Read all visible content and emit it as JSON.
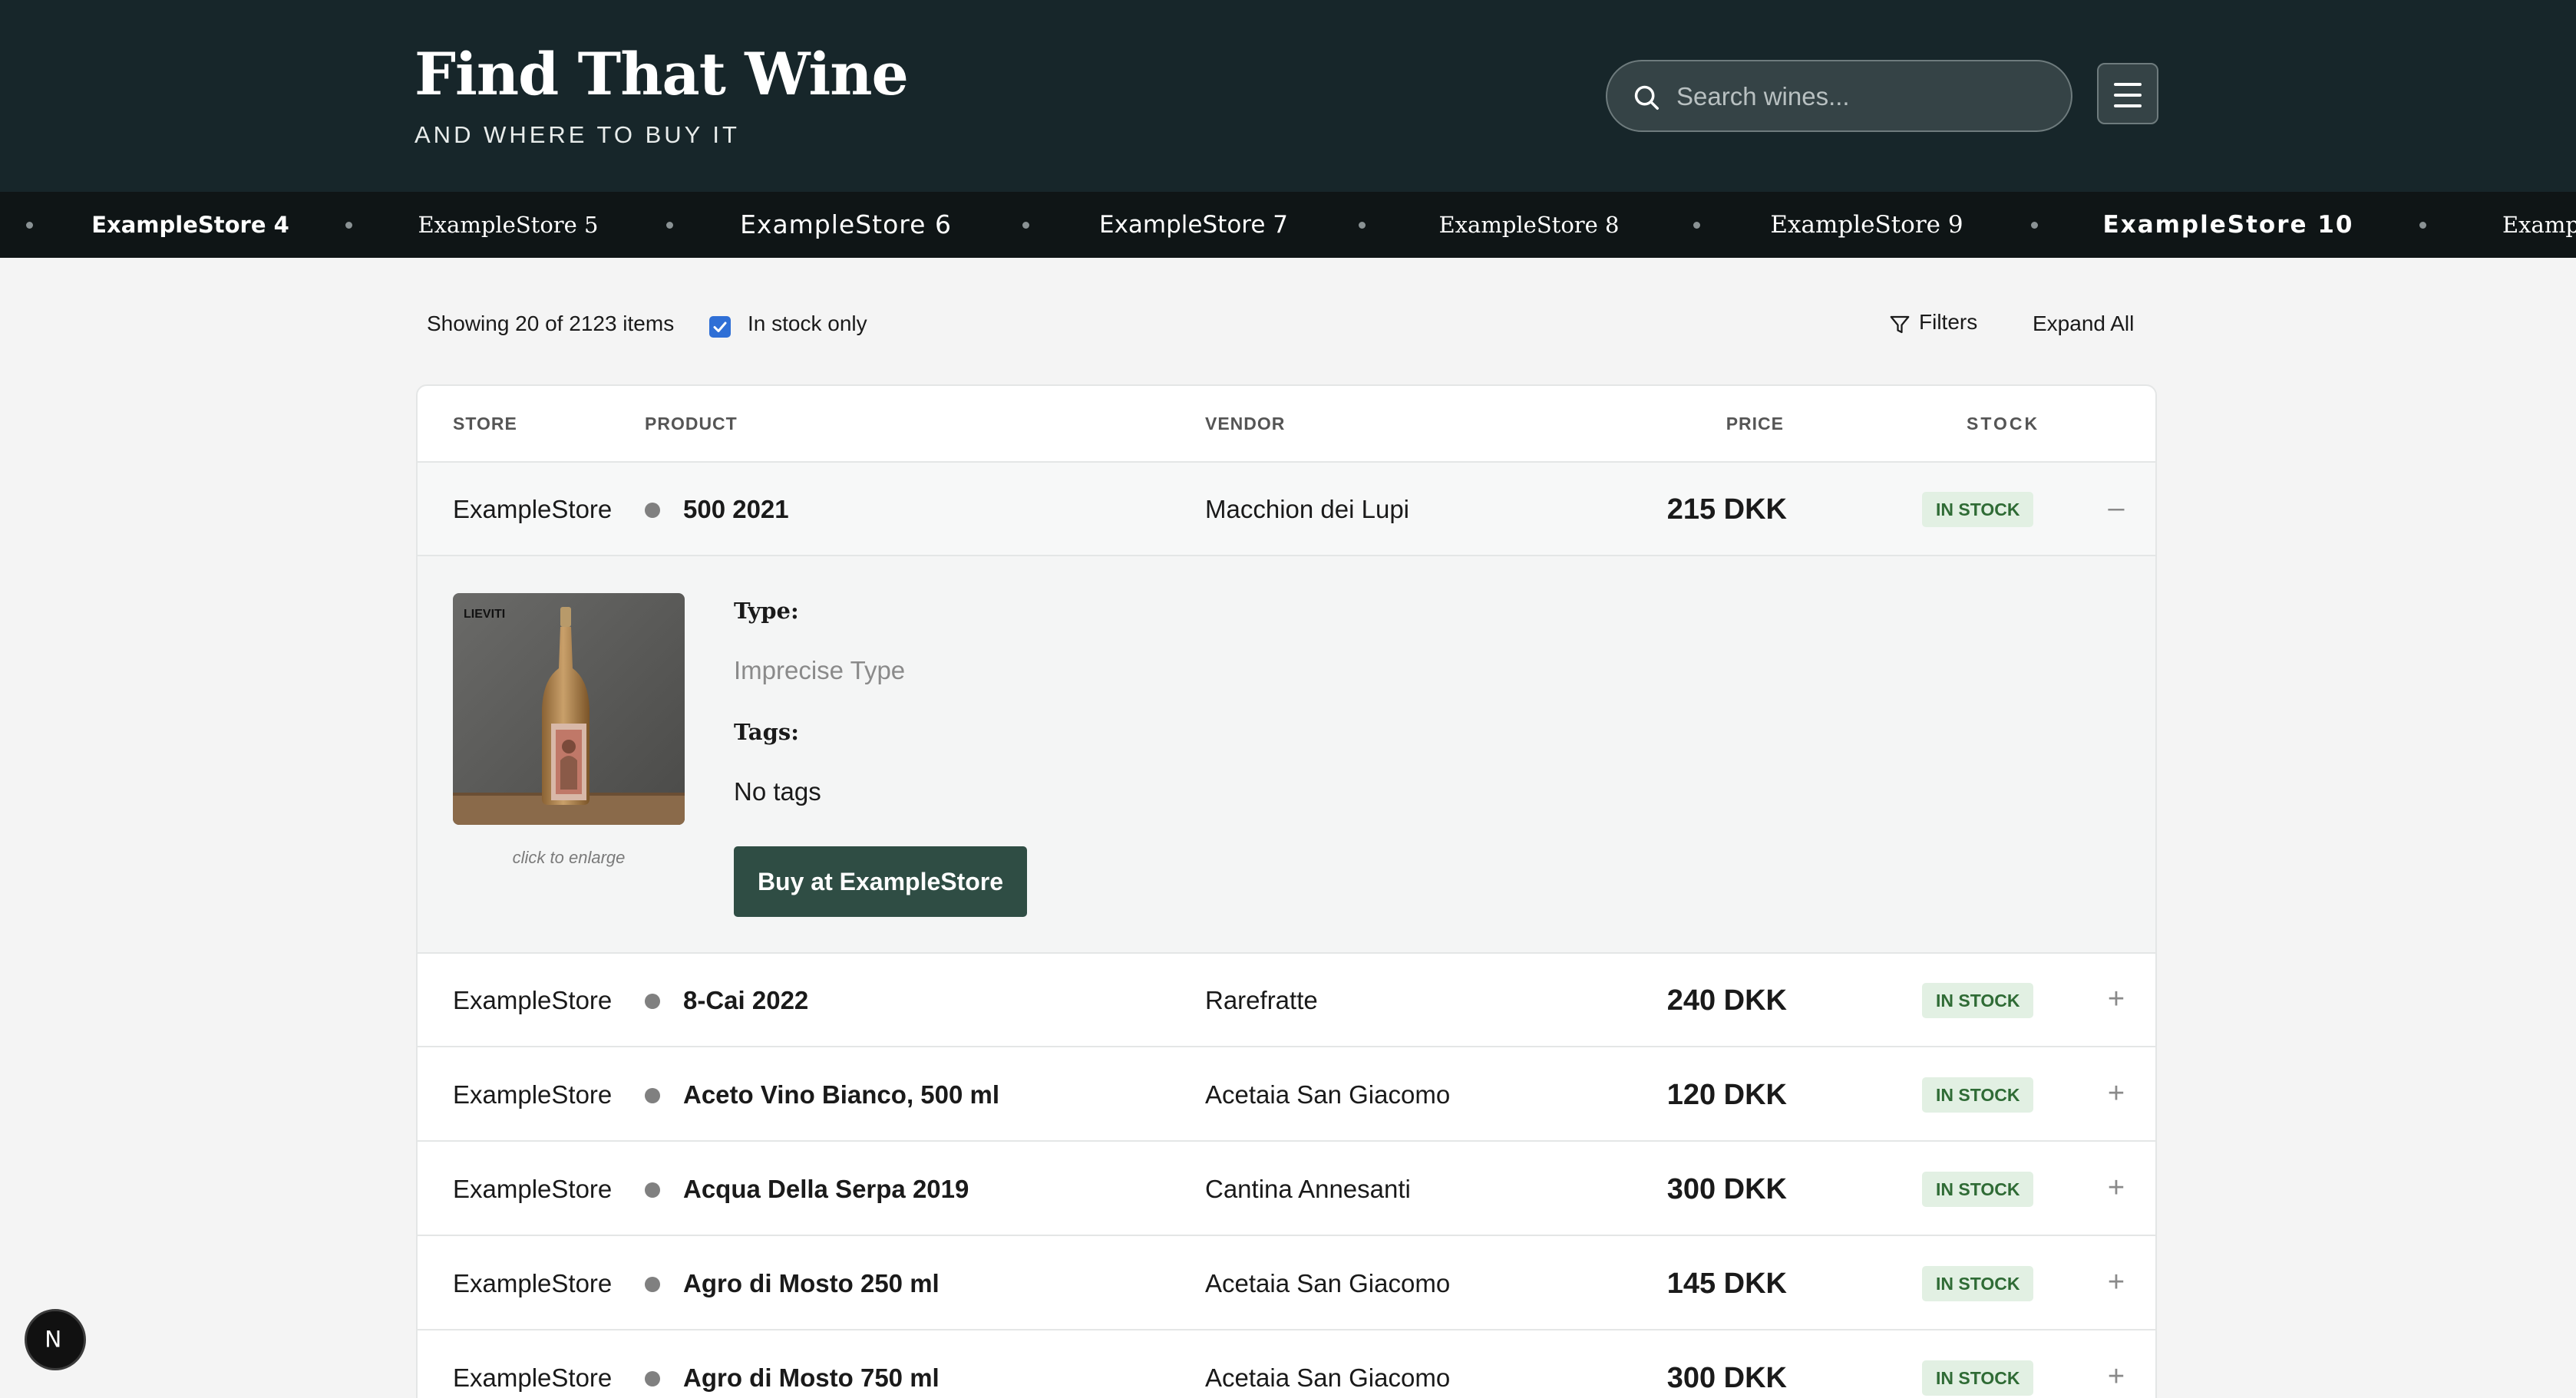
{
  "header": {
    "title": "Find That Wine",
    "subtitle": "AND WHERE TO BUY IT",
    "search_placeholder": "Search wines...",
    "menu_icon": "hamburger-menu-icon"
  },
  "store_ticker": [
    "ExampleStore 4",
    "ExampleStore 5",
    "ExampleStore 6",
    "ExampleStore 7",
    "ExampleStore 8",
    "ExampleStore 9",
    "ExampleStore 10",
    "Examp"
  ],
  "toolbar": {
    "showing": "Showing 20 of 2123 items",
    "in_stock_label": "In stock only",
    "in_stock_checked": true,
    "filters_label": "Filters",
    "expand_label": "Expand All"
  },
  "table": {
    "headers": {
      "store": "STORE",
      "product": "PRODUCT",
      "vendor": "VENDOR",
      "price": "PRICE",
      "stock": "STOCK"
    },
    "rows": [
      {
        "store": "ExampleStore",
        "product": "500 2021",
        "vendor": "Macchion dei Lupi",
        "price": "215 DKK",
        "stock": "IN STOCK",
        "toggle": "–",
        "expanded": true
      },
      {
        "store": "ExampleStore",
        "product": "8-Cai 2022",
        "vendor": "Rarefratte",
        "price": "240 DKK",
        "stock": "IN STOCK",
        "toggle": "+"
      },
      {
        "store": "ExampleStore",
        "product": "Aceto Vino Bianco, 500 ml",
        "vendor": "Acetaia San Giacomo",
        "price": "120 DKK",
        "stock": "IN STOCK",
        "toggle": "+"
      },
      {
        "store": "ExampleStore",
        "product": "Acqua Della Serpa 2019",
        "vendor": "Cantina Annesanti",
        "price": "300 DKK",
        "stock": "IN STOCK",
        "toggle": "+"
      },
      {
        "store": "ExampleStore",
        "product": "Agro di Mosto 250 ml",
        "vendor": "Acetaia San Giacomo",
        "price": "145 DKK",
        "stock": "IN STOCK",
        "toggle": "+"
      },
      {
        "store": "ExampleStore",
        "product": "Agro di Mosto 750 ml",
        "vendor": "Acetaia San Giacomo",
        "price": "300 DKK",
        "stock": "IN STOCK",
        "toggle": "+"
      }
    ],
    "detail": {
      "bottle_label": "LIEVITI",
      "enlarge_hint": "click to enlarge",
      "type_label": "Type:",
      "type_value": "Imprecise Type",
      "tags_label": "Tags:",
      "tags_value": "No tags",
      "buy_label": "Buy at ExampleStore"
    }
  },
  "dev_badge": "N"
}
